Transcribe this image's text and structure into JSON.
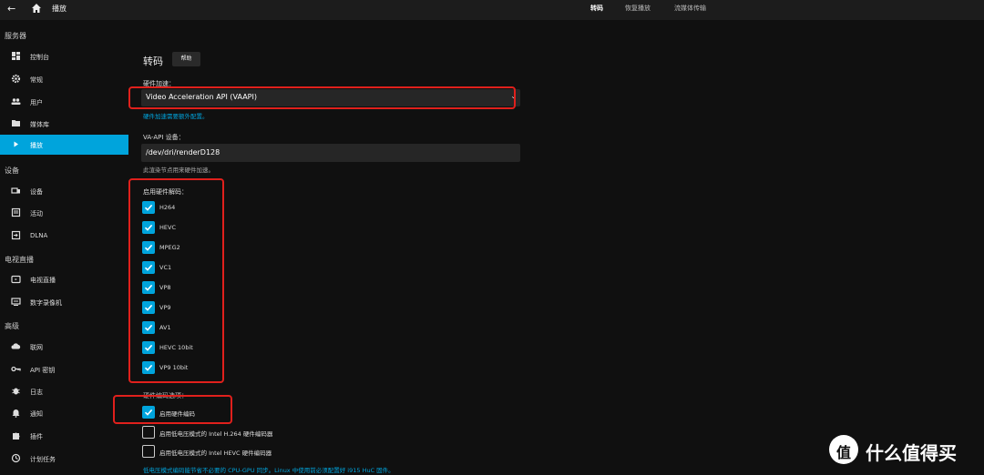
{
  "topbar": {
    "title": "播放",
    "tabs": [
      {
        "label": "转码",
        "active": true
      },
      {
        "label": "恢复播放",
        "active": false
      },
      {
        "label": "流媒体传输",
        "active": false
      }
    ]
  },
  "sidebar": {
    "sections": [
      {
        "header": "服务器",
        "items": [
          {
            "label": "控制台",
            "icon": "dashboard-icon"
          },
          {
            "label": "常规",
            "icon": "gear-icon"
          },
          {
            "label": "用户",
            "icon": "people-icon"
          },
          {
            "label": "媒体库",
            "icon": "folder-icon"
          },
          {
            "label": "播放",
            "icon": "play-icon",
            "active": true
          }
        ]
      },
      {
        "header": "设备",
        "items": [
          {
            "label": "设备",
            "icon": "devices-icon"
          },
          {
            "label": "活动",
            "icon": "activity-icon"
          },
          {
            "label": "DLNA",
            "icon": "input-icon"
          }
        ]
      },
      {
        "header": "电视直播",
        "items": [
          {
            "label": "电视直播",
            "icon": "tv-icon"
          },
          {
            "label": "数字录像机",
            "icon": "dvr-icon"
          }
        ]
      },
      {
        "header": "高级",
        "items": [
          {
            "label": "联网",
            "icon": "cloud-icon"
          },
          {
            "label": "API 密钥",
            "icon": "key-icon"
          },
          {
            "label": "日志",
            "icon": "bug-icon"
          },
          {
            "label": "通知",
            "icon": "bell-icon"
          },
          {
            "label": "插件",
            "icon": "extension-icon"
          },
          {
            "label": "计划任务",
            "icon": "schedule-icon"
          }
        ]
      }
    ]
  },
  "main": {
    "heading": "转码",
    "help_label": "帮助",
    "hw_accel_label": "硬件加速：",
    "hw_accel_value": "Video Acceleration API (VAAPI)",
    "hw_accel_link": "硬件加速需要额外配置。",
    "vaapi_device_label": "VA-API 设备：",
    "vaapi_device_value": "/dev/dri/renderD128",
    "vaapi_device_hint": "此渲染节点用来硬件加速。",
    "decoding_label": "启用硬件解码：",
    "codecs": [
      {
        "label": "H264",
        "checked": true
      },
      {
        "label": "HEVC",
        "checked": true
      },
      {
        "label": "MPEG2",
        "checked": true
      },
      {
        "label": "VC1",
        "checked": true
      },
      {
        "label": "VP8",
        "checked": true
      },
      {
        "label": "VP9",
        "checked": true
      },
      {
        "label": "AV1",
        "checked": true
      },
      {
        "label": "HEVC 10bit",
        "checked": true
      },
      {
        "label": "VP9 10bit",
        "checked": true
      }
    ],
    "encoding_label": "硬件编码选项：",
    "encoding_options": [
      {
        "label": "启用硬件编码",
        "checked": true
      },
      {
        "label": "启用低电压模式的 Intel H.264 硬件编码器",
        "checked": false
      },
      {
        "label": "启用低电压模式的 Intel HEVC 硬件编码器",
        "checked": false
      }
    ],
    "low_power_link": "低电压模式编码能节省不必要的 CPU-GPU 同步。Linux 中使用前必须配置好 i915 HuC 固件。"
  },
  "watermark": {
    "logo_char": "值",
    "text": "什么值得买"
  },
  "colors": {
    "accent": "#00a4dc",
    "highlight_box": "#e0201c",
    "background": "#101010"
  }
}
